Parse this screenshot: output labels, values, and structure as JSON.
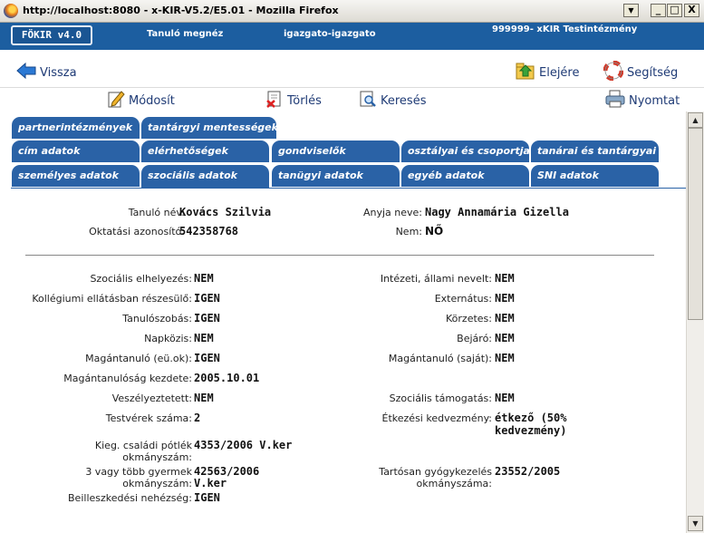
{
  "window": {
    "title": "http://localhost:8080 - x-KIR-V5.2/E5.01 - Mozilla Firefox",
    "min_label": "_",
    "max_label": "□",
    "close_label": "X"
  },
  "header": {
    "logo": "FÖKIR v4.0",
    "section": "Tanuló megnéz",
    "user": "igazgato-igazgato",
    "institution": "999999- xKIR Testintézmény"
  },
  "nav": {
    "back": "Vissza",
    "top": "Elejére",
    "help": "Segítség",
    "modify": "Módosít",
    "delete": "Törlés",
    "search": "Keresés",
    "print": "Nyomtat"
  },
  "tabs": [
    {
      "label": "partnerintézmények"
    },
    {
      "label": "tantárgyi mentességek"
    },
    {
      "label": "cím adatok"
    },
    {
      "label": "elérhetőségek"
    },
    {
      "label": "gondviselők"
    },
    {
      "label": "osztályai és csoportjai"
    },
    {
      "label": "tanárai és tantárgyai"
    },
    {
      "label": "személyes adatok"
    },
    {
      "label": "szociális adatok"
    },
    {
      "label": "tanügyi adatok"
    },
    {
      "label": "egyéb adatok"
    },
    {
      "label": "SNI adatok"
    }
  ],
  "student": {
    "name_label": "Tanuló név:",
    "name": "Kovács Szilvia",
    "id_label": "Oktatási azonosító:",
    "id": "542358768",
    "mother_label": "Anyja neve:",
    "mother": "Nagy Annamária Gizella",
    "gender_label": "Nem:",
    "gender": "NŐ"
  },
  "fields_left": [
    {
      "label": "Szociális elhelyezés:",
      "value": "NEM"
    },
    {
      "label": "Kollégiumi ellátásban részesülő:",
      "value": "IGEN"
    },
    {
      "label": "Tanulószobás:",
      "value": "IGEN"
    },
    {
      "label": "Napközis:",
      "value": "NEM"
    },
    {
      "label": "Magántanuló (eü.ok):",
      "value": "IGEN"
    },
    {
      "label": "Magántanulóság kezdete:",
      "value": "2005.10.01"
    },
    {
      "label": "Veszélyeztetett:",
      "value": "NEM"
    },
    {
      "label": "Testvérek száma:",
      "value": "2"
    },
    {
      "label1": "Kieg. családi pótlék",
      "label2": "okmányszám:",
      "value": "4353/2006 V.ker"
    },
    {
      "label1": "3 vagy több gyermek",
      "label2": "okmányszám:",
      "value1": "42563/2006",
      "value2": "V.ker"
    },
    {
      "label": "Beilleszkedési nehézség:",
      "value": "IGEN"
    }
  ],
  "fields_right": [
    {
      "label": "Intézeti, állami nevelt:",
      "value": "NEM"
    },
    {
      "label": "Externátus:",
      "value": "NEM"
    },
    {
      "label": "Körzetes:",
      "value": "NEM"
    },
    {
      "label": "Bejáró:",
      "value": "NEM"
    },
    {
      "label": "Magántanuló (saját):",
      "value": "NEM"
    },
    {
      "label": "Szociális támogatás:",
      "value": "NEM"
    },
    {
      "label": "Étkezési kedvezmény:",
      "value1": "étkező (50%",
      "value2": "kedvezmény)"
    },
    {
      "label1": "Tartósan gyógykezelés",
      "label2": "okmányszáma:",
      "value": "23552/2005"
    }
  ],
  "scrollbar": {
    "up": "▲",
    "down": "▼"
  },
  "colors": {
    "header_bg": "#1c5ea0",
    "tab_bg": "#2a62a6",
    "link": "#1e3a75"
  }
}
